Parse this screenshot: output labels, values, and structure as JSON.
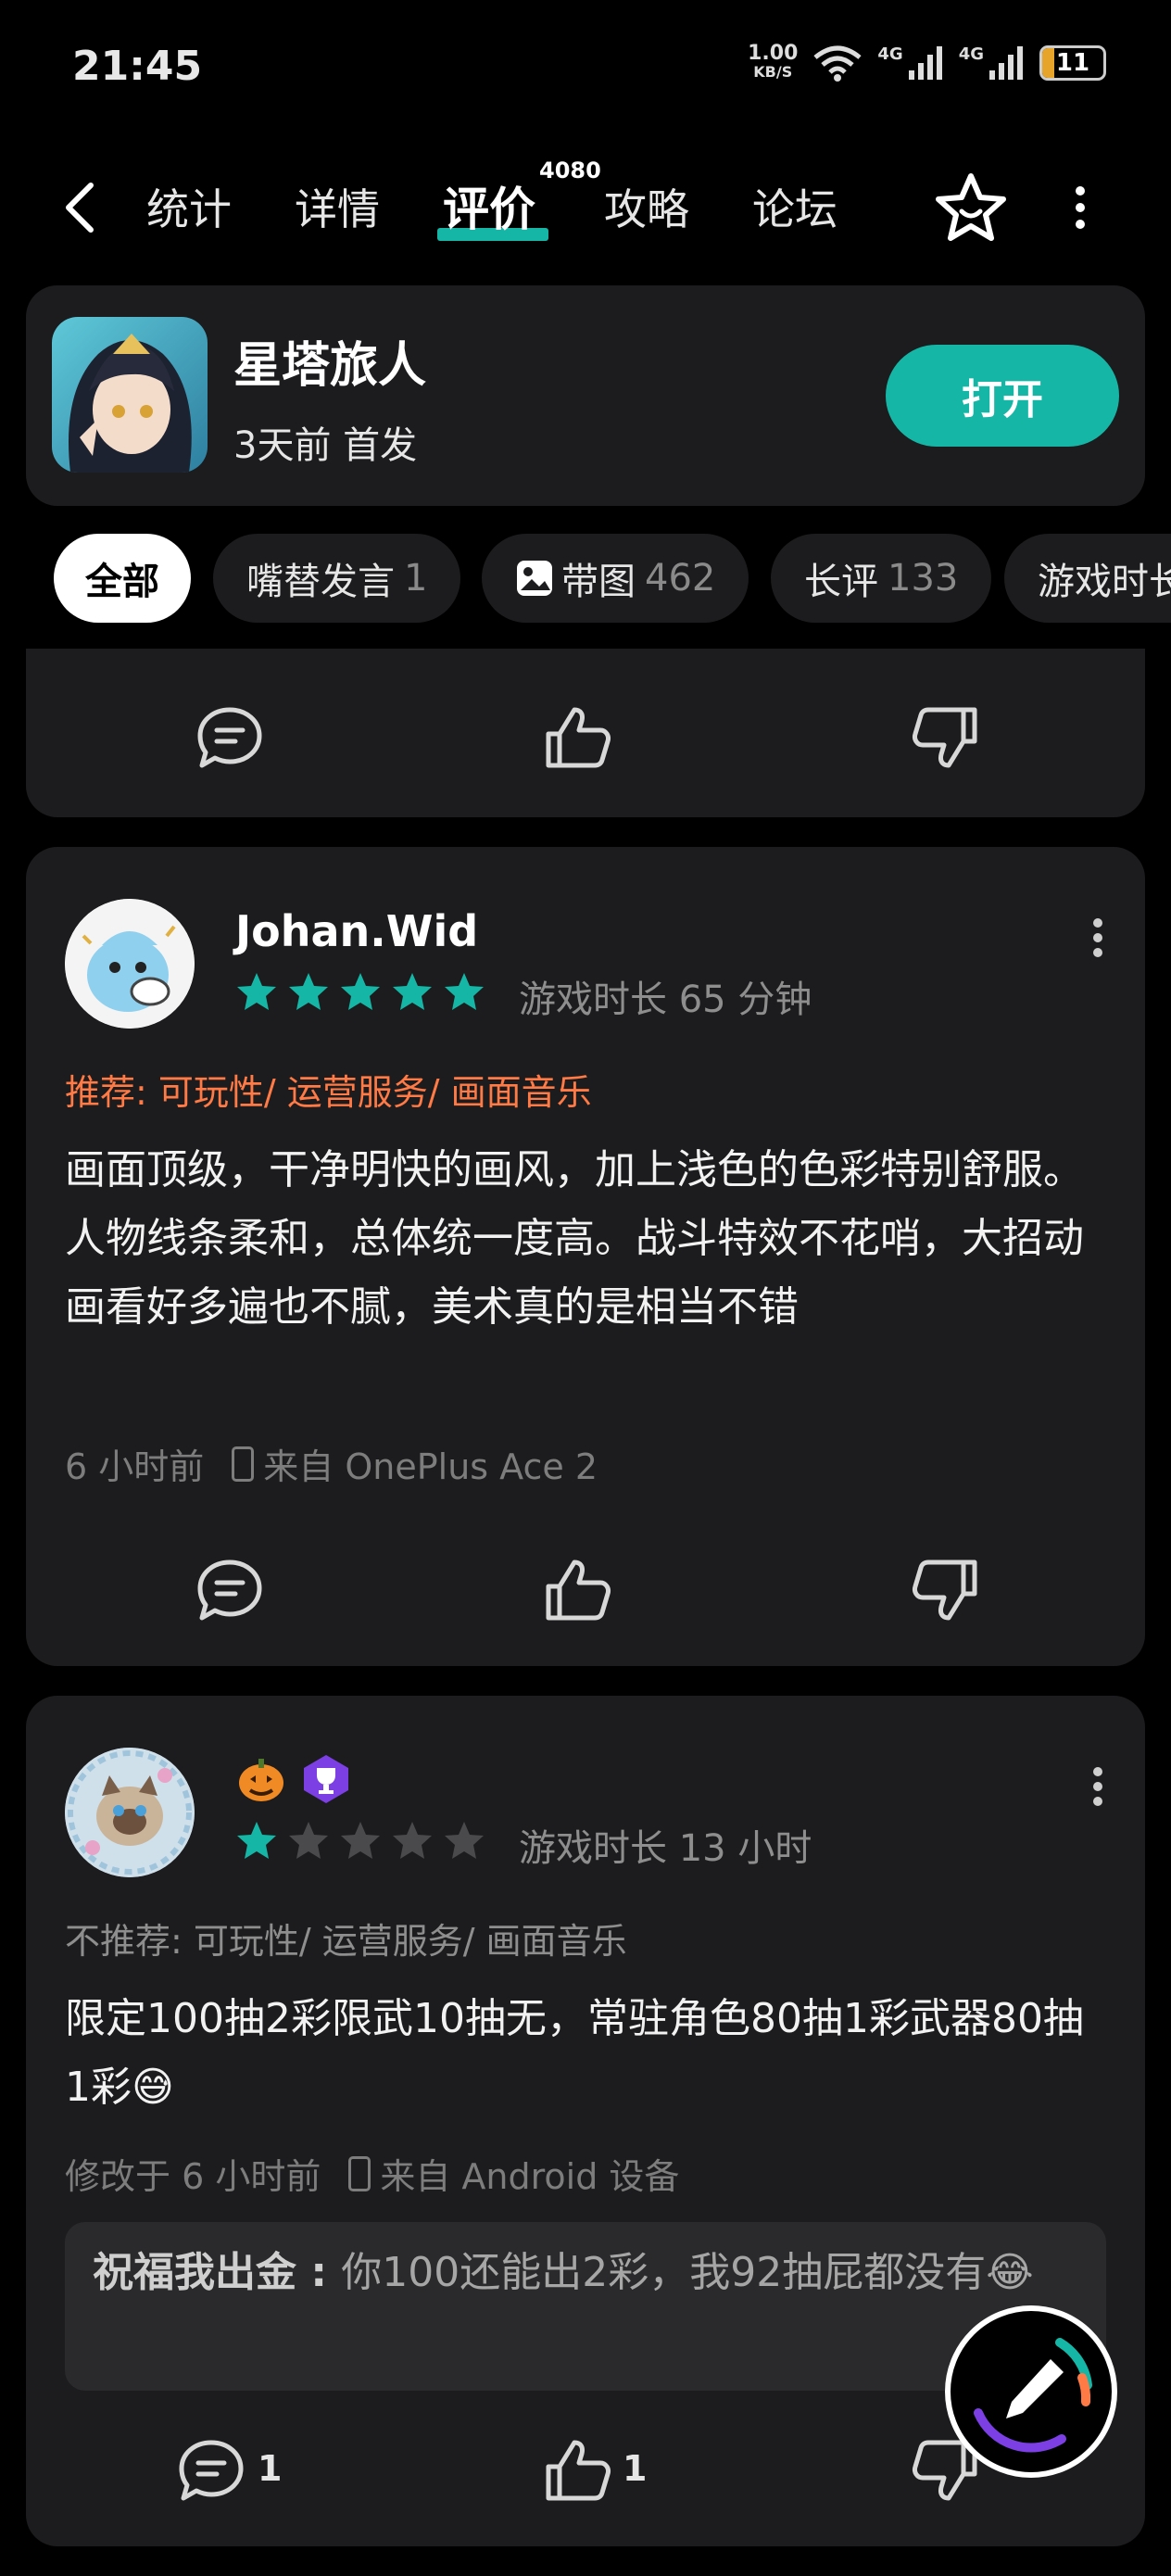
{
  "status": {
    "time": "21:45",
    "net_speed_value": "1.00",
    "net_speed_unit": "KB/S",
    "signal1": "4G",
    "signal2": "4G",
    "battery": "11"
  },
  "nav": {
    "tabs": [
      {
        "label": "统计"
      },
      {
        "label": "详情"
      },
      {
        "label": "评价"
      },
      {
        "label": "攻略"
      },
      {
        "label": "论坛"
      }
    ],
    "review_count": "4080"
  },
  "game": {
    "title": "星塔旅人",
    "subtitle": "3天前 首发",
    "open_label": "打开"
  },
  "filters": [
    {
      "label": "全部",
      "count": ""
    },
    {
      "label": "嘴替发言",
      "count": "1"
    },
    {
      "label": "带图",
      "count": "462"
    },
    {
      "label": "长评",
      "count": "133"
    },
    {
      "label": "游戏时长",
      "count": ""
    }
  ],
  "reviews": [
    {
      "username": "Johan.Wid",
      "stars": 5,
      "playtime": "游戏时长 65 分钟",
      "recommend": "推荐: 可玩性/ 运营服务/ 画面音乐",
      "body": "画面顶级，干净明快的画风，加上浅色的色彩特别舒服。人物线条柔和，总体统一度高。战斗特效不花哨，大招动画看好多遍也不腻，美术真的是相当不错",
      "time": "6 小时前",
      "device": "来自 OnePlus Ace 2"
    },
    {
      "username": "",
      "stars": 1,
      "playtime": "游戏时长 13 小时",
      "recommend": "不推荐: 可玩性/ 运营服务/ 画面音乐",
      "body": "限定100抽2彩限武10抽无，常驻角色80抽1彩武器80抽1彩😅",
      "time": "修改于 6 小时前",
      "device": "来自 Android 设备",
      "reply_author": "祝福我出金",
      "reply_text": "你100还能出2彩，我92抽屁都没有😂",
      "comment_count": "1",
      "like_count": "1"
    }
  ],
  "colors": {
    "accent": "#16b6a6",
    "recommend": "#ff7a45",
    "card": "#1c1c1e"
  }
}
